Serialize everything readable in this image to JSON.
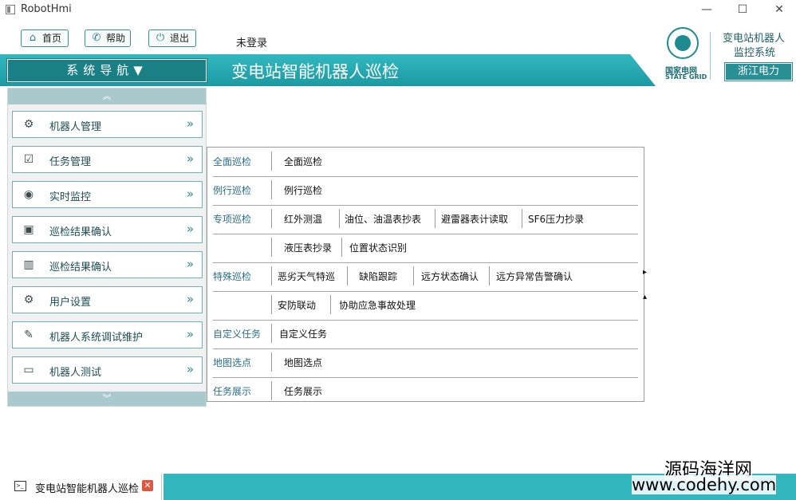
{
  "window": {
    "title": "RobotHmi",
    "minimize": "—",
    "maximize": "☐",
    "close": "✕"
  },
  "toolbar": {
    "home_label": "首页",
    "help_label": "帮助",
    "logout_label": "退出",
    "login_status": "未登录"
  },
  "brand": {
    "logo_cn": "国家电网",
    "logo_en": "STATE GRID",
    "system_line1": "变电站机器人",
    "system_line2": "监控系统",
    "province": "浙江电力"
  },
  "header": {
    "nav_title": "系统导航",
    "page_title": "变电站智能机器人巡检"
  },
  "sidebar": {
    "items": [
      {
        "label": "机器人管理",
        "icon": "robot-icon"
      },
      {
        "label": "任务管理",
        "icon": "task-icon"
      },
      {
        "label": "实时监控",
        "icon": "camera-icon"
      },
      {
        "label": "巡检结果确认",
        "icon": "result-icon"
      },
      {
        "label": "巡检结果确认",
        "icon": "chart-icon"
      },
      {
        "label": "用户设置",
        "icon": "gear-icon"
      },
      {
        "label": "机器人系统调试维护",
        "icon": "wrench-icon"
      },
      {
        "label": "机器人测试",
        "icon": "terminal-icon"
      }
    ]
  },
  "menu": {
    "rows": [
      {
        "category": "全面巡检",
        "options": [
          "全面巡检"
        ]
      },
      {
        "category": "例行巡检",
        "options": [
          "例行巡检"
        ]
      },
      {
        "category": "专项巡检",
        "options": [
          "红外测温",
          "油位、油温表抄表",
          "避雷器表计读取",
          "SF6压力抄录"
        ]
      },
      {
        "category": "",
        "options": [
          "液压表抄录",
          "位置状态识别"
        ]
      },
      {
        "category": "特殊巡检",
        "options": [
          "恶劣天气特巡",
          "缺陷跟踪",
          "远方状态确认",
          "远方异常告警确认"
        ]
      },
      {
        "category": "",
        "options": [
          "安防联动",
          "协助应急事故处理"
        ]
      },
      {
        "category": "自定义任务",
        "options": [
          "自定义任务"
        ]
      },
      {
        "category": "地图选点",
        "options": [
          "地图选点"
        ]
      },
      {
        "category": "任务展示",
        "options": [
          "任务展示"
        ]
      }
    ]
  },
  "taskbar": {
    "tab_label": "变电站智能机器人巡检",
    "close_glyph": "✕"
  },
  "watermark": {
    "line1": "源码海洋网",
    "line2": "www.codehy.com"
  }
}
